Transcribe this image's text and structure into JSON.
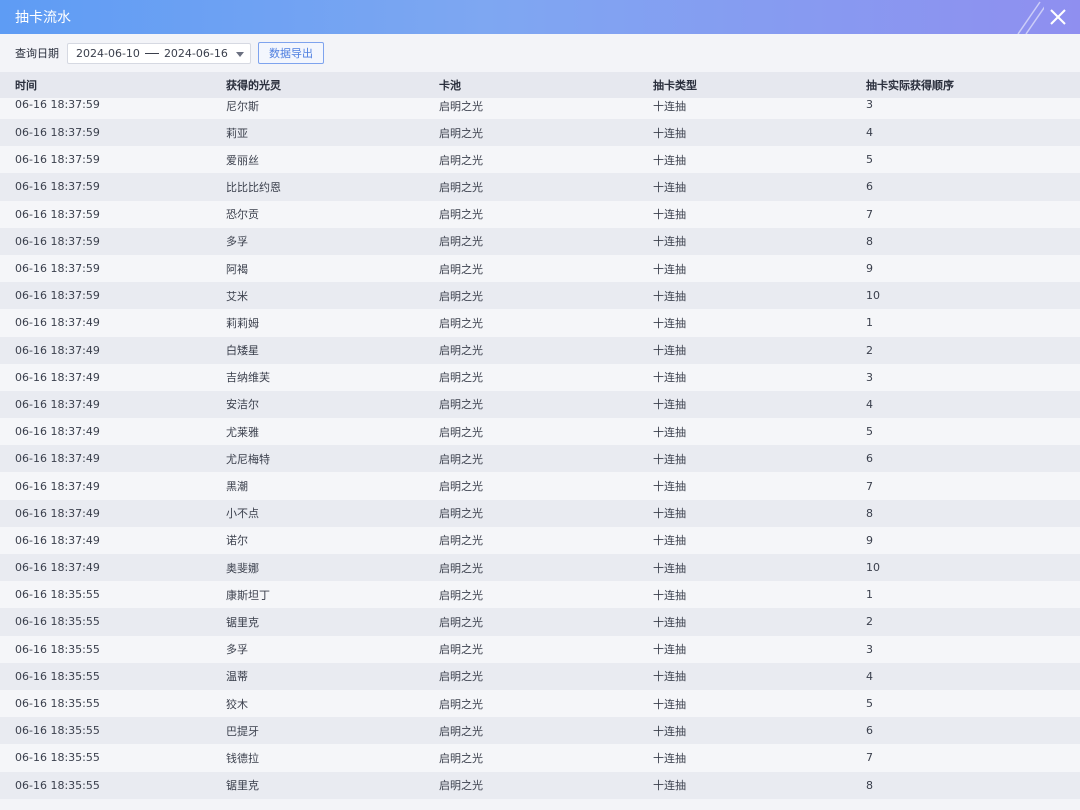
{
  "window": {
    "title": "抽卡流水"
  },
  "toolbar": {
    "date_label": "查询日期",
    "date_start": "2024-06-10",
    "date_end": "2024-06-16",
    "export_label": "数据导出"
  },
  "table": {
    "columns": [
      "时间",
      "获得的光灵",
      "卡池",
      "抽卡类型",
      "抽卡实际获得顺序"
    ],
    "rows": [
      [
        "06-16 18:37:59",
        "尼尔斯",
        "启明之光",
        "十连抽",
        "3"
      ],
      [
        "06-16 18:37:59",
        "莉亚",
        "启明之光",
        "十连抽",
        "4"
      ],
      [
        "06-16 18:37:59",
        "爱丽丝",
        "启明之光",
        "十连抽",
        "5"
      ],
      [
        "06-16 18:37:59",
        "比比比约恩",
        "启明之光",
        "十连抽",
        "6"
      ],
      [
        "06-16 18:37:59",
        "恐尔贡",
        "启明之光",
        "十连抽",
        "7"
      ],
      [
        "06-16 18:37:59",
        "多孚",
        "启明之光",
        "十连抽",
        "8"
      ],
      [
        "06-16 18:37:59",
        "阿褐",
        "启明之光",
        "十连抽",
        "9"
      ],
      [
        "06-16 18:37:59",
        "艾米",
        "启明之光",
        "十连抽",
        "10"
      ],
      [
        "06-16 18:37:49",
        "莉莉姆",
        "启明之光",
        "十连抽",
        "1"
      ],
      [
        "06-16 18:37:49",
        "白矮星",
        "启明之光",
        "十连抽",
        "2"
      ],
      [
        "06-16 18:37:49",
        "吉纳维芙",
        "启明之光",
        "十连抽",
        "3"
      ],
      [
        "06-16 18:37:49",
        "安洁尔",
        "启明之光",
        "十连抽",
        "4"
      ],
      [
        "06-16 18:37:49",
        "尤莱雅",
        "启明之光",
        "十连抽",
        "5"
      ],
      [
        "06-16 18:37:49",
        "尤尼梅特",
        "启明之光",
        "十连抽",
        "6"
      ],
      [
        "06-16 18:37:49",
        "黑潮",
        "启明之光",
        "十连抽",
        "7"
      ],
      [
        "06-16 18:37:49",
        "小不点",
        "启明之光",
        "十连抽",
        "8"
      ],
      [
        "06-16 18:37:49",
        "诺尔",
        "启明之光",
        "十连抽",
        "9"
      ],
      [
        "06-16 18:37:49",
        "奥斐娜",
        "启明之光",
        "十连抽",
        "10"
      ],
      [
        "06-16 18:35:55",
        "康斯坦丁",
        "启明之光",
        "十连抽",
        "1"
      ],
      [
        "06-16 18:35:55",
        "锯里克",
        "启明之光",
        "十连抽",
        "2"
      ],
      [
        "06-16 18:35:55",
        "多孚",
        "启明之光",
        "十连抽",
        "3"
      ],
      [
        "06-16 18:35:55",
        "温蒂",
        "启明之光",
        "十连抽",
        "4"
      ],
      [
        "06-16 18:35:55",
        "狡木",
        "启明之光",
        "十连抽",
        "5"
      ],
      [
        "06-16 18:35:55",
        "巴提牙",
        "启明之光",
        "十连抽",
        "6"
      ],
      [
        "06-16 18:35:55",
        "钱德拉",
        "启明之光",
        "十连抽",
        "7"
      ],
      [
        "06-16 18:35:55",
        "锯里克",
        "启明之光",
        "十连抽",
        "8"
      ]
    ]
  },
  "colors": {
    "title_gradient_start": "#5e9cf4",
    "title_gradient_end": "#8f8ff0",
    "export_button_text": "#4f7fe0"
  },
  "icons": {
    "close": "close-icon",
    "dropdown": "chevron-down-icon"
  }
}
